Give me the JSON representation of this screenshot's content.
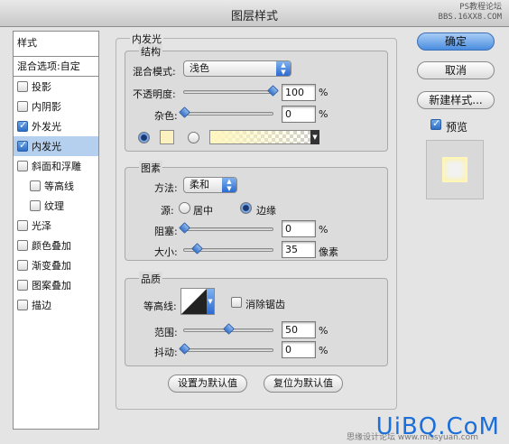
{
  "window": {
    "title": "图层样式",
    "watermark_lines": [
      "PS教程论坛",
      "BBS.16XX8.COM"
    ]
  },
  "sidebar": {
    "header": "样式",
    "blend_options": "混合选项:自定",
    "items": [
      {
        "label": "投影",
        "checked": false,
        "indent": false,
        "selected": false
      },
      {
        "label": "内阴影",
        "checked": false,
        "indent": false,
        "selected": false
      },
      {
        "label": "外发光",
        "checked": true,
        "indent": false,
        "selected": false
      },
      {
        "label": "内发光",
        "checked": true,
        "indent": false,
        "selected": true
      },
      {
        "label": "斜面和浮雕",
        "checked": false,
        "indent": false,
        "selected": false
      },
      {
        "label": "等高线",
        "checked": false,
        "indent": true,
        "selected": false
      },
      {
        "label": "纹理",
        "checked": false,
        "indent": true,
        "selected": false
      },
      {
        "label": "光泽",
        "checked": false,
        "indent": false,
        "selected": false
      },
      {
        "label": "颜色叠加",
        "checked": false,
        "indent": false,
        "selected": false
      },
      {
        "label": "渐变叠加",
        "checked": false,
        "indent": false,
        "selected": false
      },
      {
        "label": "图案叠加",
        "checked": false,
        "indent": false,
        "selected": false
      },
      {
        "label": "描边",
        "checked": false,
        "indent": false,
        "selected": false
      }
    ]
  },
  "panel": {
    "title": "内发光",
    "structure": {
      "label": "结构",
      "blend_mode_label": "混合模式:",
      "blend_mode_value": "浅色",
      "opacity_label": "不透明度:",
      "opacity_value": "100",
      "opacity_level": 100,
      "noise_label": "杂色:",
      "noise_value": "0",
      "noise_level": 0,
      "percent": "%"
    },
    "elements": {
      "label": "图素",
      "method_label": "方法:",
      "method_value": "柔和",
      "source_label": "源:",
      "source_center": "居中",
      "source_edge": "边缘",
      "choke_label": "阻塞:",
      "choke_value": "0",
      "choke_level": 0,
      "size_label": "大小:",
      "size_value": "35",
      "size_level": 14,
      "size_unit": "像素",
      "percent": "%"
    },
    "quality": {
      "label": "品质",
      "contour_label": "等高线:",
      "antialias_label": "消除锯齿",
      "range_label": "范围:",
      "range_value": "50",
      "range_level": 50,
      "jitter_label": "抖动:",
      "jitter_value": "0",
      "jitter_level": 0,
      "percent": "%"
    },
    "make_default": "设置为默认值",
    "reset_default": "复位为默认值"
  },
  "buttons": {
    "ok": "确定",
    "cancel": "取消",
    "new_style": "新建样式...",
    "preview": "预览"
  },
  "brand": {
    "text": "UiBQ.CoM",
    "sub": "思缘设计论坛 www.missyuan.com"
  },
  "colors": {
    "accent": "#4a8ddf",
    "selection": "#b5d0ef",
    "glow": "#fdf1bf"
  }
}
